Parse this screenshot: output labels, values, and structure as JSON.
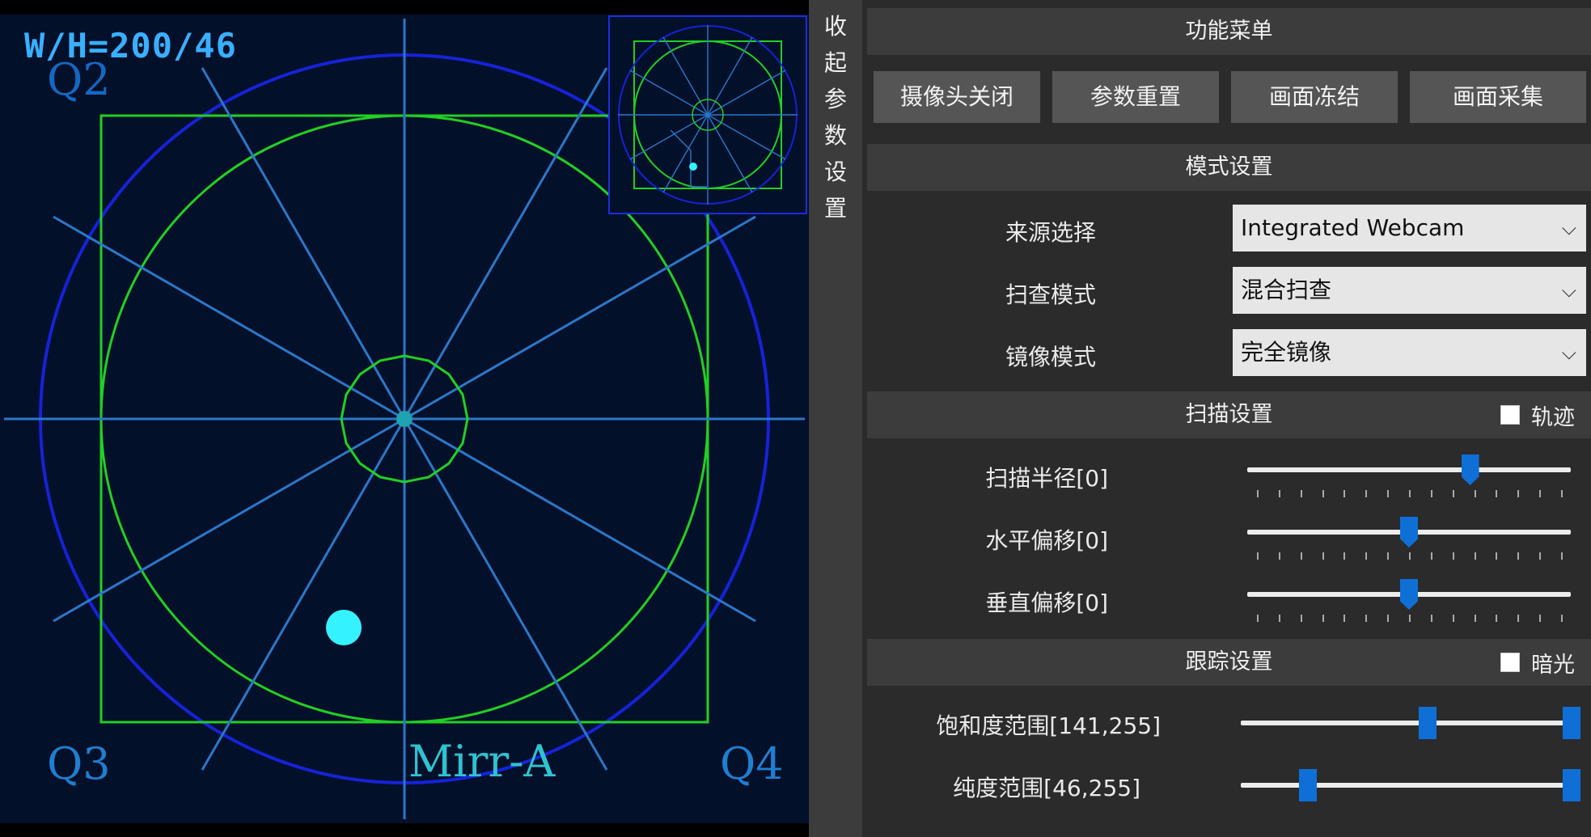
{
  "viewport": {
    "wh_text": "W/H=200/46",
    "quadrants": {
      "q2": "Q2",
      "q3": "Q3",
      "q4": "Q4"
    },
    "mode_label": "Mirr-A",
    "colors": {
      "outer_circle": "#1622d8",
      "green": "#21d022",
      "spokes": "#2a78c8",
      "dot": "#34f2ff"
    }
  },
  "sidebar_toggle": {
    "chars": [
      "收",
      "起",
      "参",
      "数",
      "设",
      "置"
    ]
  },
  "panel": {
    "menu": {
      "title": "功能菜单",
      "buttons": [
        "摄像头关闭",
        "参数重置",
        "画面冻结",
        "画面采集"
      ]
    },
    "mode": {
      "title": "模式设置",
      "fields": [
        {
          "label": "来源选择",
          "value": "Integrated Webcam"
        },
        {
          "label": "扫查模式",
          "value": "混合扫查"
        },
        {
          "label": "镜像模式",
          "value": "完全镜像"
        }
      ]
    },
    "scan": {
      "title": "扫描设置",
      "checkbox_label": "轨迹",
      "checkbox_checked": false,
      "sliders": [
        {
          "label": "扫描半径[0]",
          "value_fraction": 0.7
        },
        {
          "label": "水平偏移[0]",
          "value_fraction": 0.5
        },
        {
          "label": "垂直偏移[0]",
          "value_fraction": 0.5
        }
      ]
    },
    "track": {
      "title": "跟踪设置",
      "checkbox_label": "暗光",
      "checkbox_checked": false,
      "ranges": [
        {
          "label": "饱和度范围[141,255]",
          "low": 141,
          "high": 255,
          "max": 255
        },
        {
          "label": "纯度范围[46,255]",
          "low": 46,
          "high": 255,
          "max": 255
        }
      ]
    }
  }
}
